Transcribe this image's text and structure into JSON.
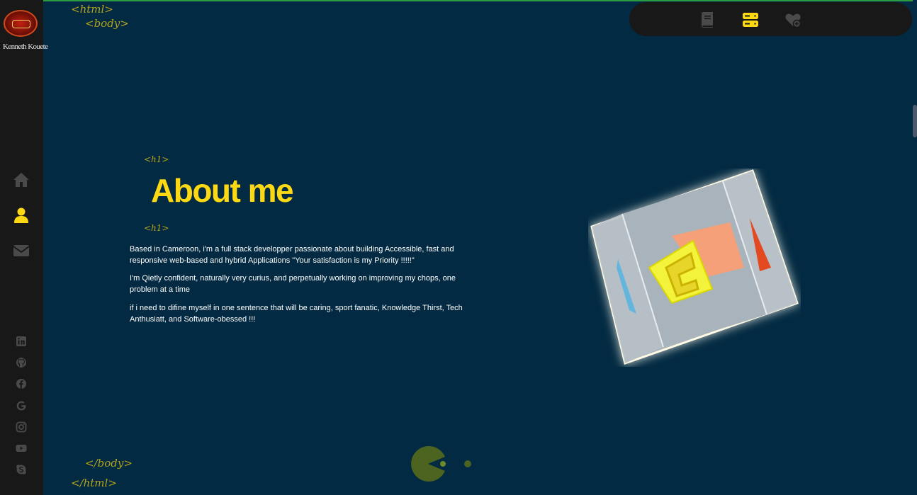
{
  "app": {
    "logo_text": "Kenneth Kouete"
  },
  "code_tags": {
    "html_open": "<html>",
    "body_open": "<body>",
    "h1_open": "<h1>",
    "h1_close": "<h1>",
    "body_close": "</body>",
    "html_close": "</html>"
  },
  "nav": {
    "items": [
      {
        "icon": "home-icon",
        "active": false
      },
      {
        "icon": "user-icon",
        "active": true
      },
      {
        "icon": "envelope-icon",
        "active": false
      }
    ]
  },
  "social": [
    "linkedin-icon",
    "github-icon",
    "facebook-icon",
    "google-icon",
    "instagram-icon",
    "youtube-icon",
    "skype-icon"
  ],
  "topbar": {
    "icons": [
      {
        "icon": "book-icon",
        "active": false
      },
      {
        "icon": "server-icon",
        "active": true
      },
      {
        "icon": "heart-plus-icon",
        "active": false
      }
    ]
  },
  "main": {
    "title": "About me",
    "paragraphs": [
      "Based in Cameroon, i'm a full stack developper passionate about building Accessible, fast and responsive web-based and hybrid Applications \"Your satisfaction is my Priority !!!!!\"",
      "I'm Qietly confident, naturally very curius, and perpetually working on improving my chops, one problem at a time",
      "if i need to difine myself in one sentence that will be caring, sport fanatic, Knowledge Thirst, Tech Anthusiatt, and Software-obessed !!!"
    ]
  },
  "colors": {
    "background": "#022a42",
    "sidebar": "#181818",
    "accent": "#ffd814",
    "icon_inactive": "#4a4a4a"
  }
}
